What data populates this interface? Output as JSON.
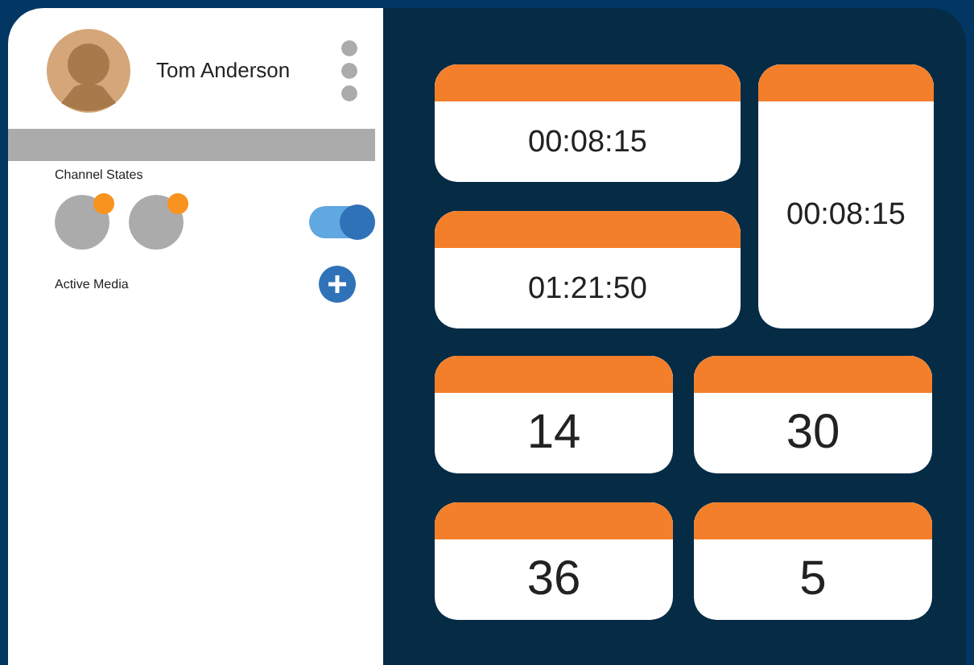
{
  "user": {
    "name": "Tom Anderson"
  },
  "channel_states": {
    "label": "Channel States",
    "channels": [
      {
        "indicator": true
      },
      {
        "indicator": true
      }
    ],
    "toggle": {
      "on": true
    }
  },
  "active_media": {
    "label": "Active Media"
  },
  "timers": [
    {
      "value": "00:08:15",
      "kind": "wide"
    },
    {
      "value": "00:08:15",
      "kind": "tall"
    },
    {
      "value": "01:21:50",
      "kind": "wide"
    }
  ],
  "counters": [
    {
      "value": "14"
    },
    {
      "value": "30"
    },
    {
      "value": "36"
    },
    {
      "value": "5"
    }
  ]
}
